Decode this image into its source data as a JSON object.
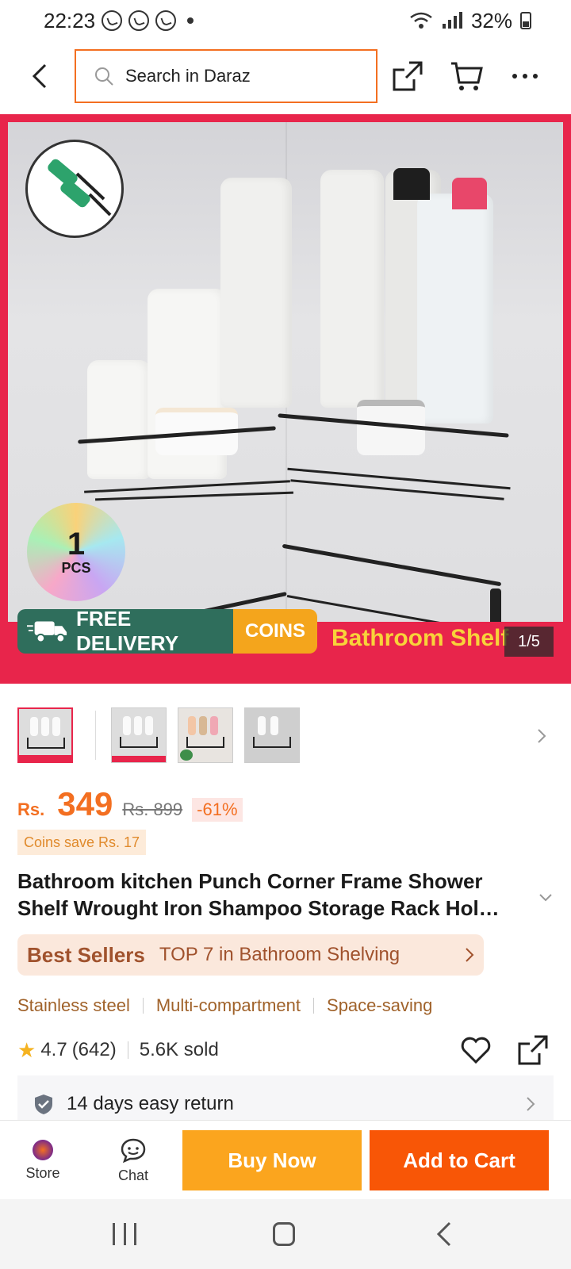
{
  "status_bar": {
    "time": "22:23",
    "battery": "32%"
  },
  "top_nav": {
    "search_placeholder": "Search in Daraz"
  },
  "hero": {
    "pcs_number": "1",
    "pcs_label": "PCS",
    "free_delivery": "FREE DELIVERY",
    "coins": "COINS",
    "caption": "Bathroom Shelf",
    "counter": "1/5"
  },
  "price": {
    "currency": "Rs.",
    "value": "349",
    "original": "Rs. 899",
    "discount": "-61%",
    "coins_save": "Coins save Rs. 17"
  },
  "product": {
    "title": "Bathroom kitchen Punch Corner Frame Shower Shelf Wrought Iron Shampoo Storage Rack Hol…"
  },
  "best_sellers": {
    "label": "Best Sellers",
    "rank": "TOP 7 in Bathroom Shelving"
  },
  "features": [
    "Stainless steel",
    "Multi-compartment",
    "Space-saving"
  ],
  "rating": {
    "score": "4.7",
    "count": "(642)",
    "sold": "5.6K sold"
  },
  "returns": {
    "text": "14 days easy return"
  },
  "action_bar": {
    "store_label": "Store",
    "chat_label": "Chat",
    "buy_now": "Buy Now",
    "add_to_cart": "Add to Cart"
  },
  "colors": {
    "accent_orange": "#f85606",
    "buy_now_yellow": "#fba51e",
    "banner_red": "#e8254b",
    "delivery_green": "#2f6e5c"
  }
}
